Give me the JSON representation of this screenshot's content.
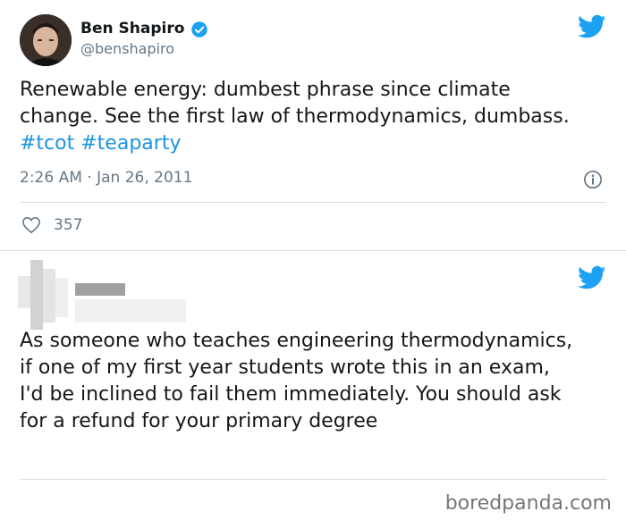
{
  "tweet1": {
    "author_name": "Ben Shapiro",
    "handle": "@benshapiro",
    "text_plain": "Renewable energy: dumbest phrase since climate change. See the first law of thermodynamics, dumbass. ",
    "hashtags": [
      "#tcot",
      "#teaparty"
    ],
    "timestamp": "2:26 AM · Jan 26, 2011",
    "likes": "357",
    "icons": [
      "avatar",
      "verified-badge-icon",
      "twitter-bird-icon",
      "info-icon",
      "heart-icon"
    ],
    "colors": {
      "link": "#1b95e0",
      "muted": "#657786",
      "twitter_blue": "#1da1f2"
    }
  },
  "tweet2": {
    "text": "As someone who teaches engineering thermodynamics, if one of my first year students wrote this in an exam, I'd be inclined to fail them immediately. You should ask for a refund for your primary degree",
    "icons": [
      "blurred-avatar",
      "twitter-bird-icon"
    ]
  },
  "footer": {
    "watermark": "boredpanda.com"
  }
}
